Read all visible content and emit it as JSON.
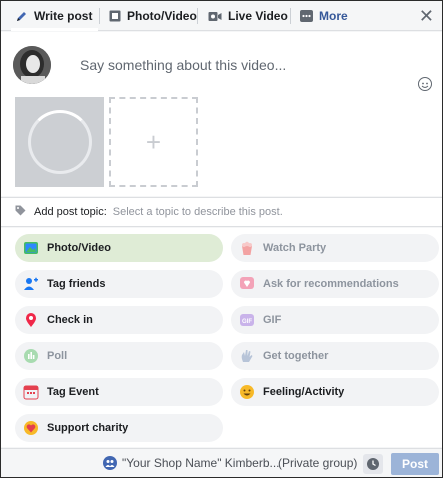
{
  "tabs": {
    "write_post": "Write post",
    "photo_video": "Photo/Video",
    "live_video": "Live Video",
    "more": "More"
  },
  "composer": {
    "placeholder": "Say something about this video...",
    "add_media_symbol": "+"
  },
  "topic": {
    "label": "Add post topic:",
    "placeholder": "Select a topic to describe this post."
  },
  "options": {
    "photo_video": "Photo/Video",
    "watch_party": "Watch Party",
    "tag_friends": "Tag friends",
    "ask_recommendations": "Ask for recommendations",
    "check_in": "Check in",
    "gif": "GIF",
    "poll": "Poll",
    "get_together": "Get together",
    "tag_event": "Tag Event",
    "feeling_activity": "Feeling/Activity",
    "support_charity": "Support charity"
  },
  "footer": {
    "audience": "\"Your Shop Name\" Kimberb...",
    "privacy": "(Private group)",
    "post_label": "Post"
  },
  "colors": {
    "accent": "#4267b2",
    "active_option": "#dfecd6",
    "post_button": "#9cb4d8"
  }
}
